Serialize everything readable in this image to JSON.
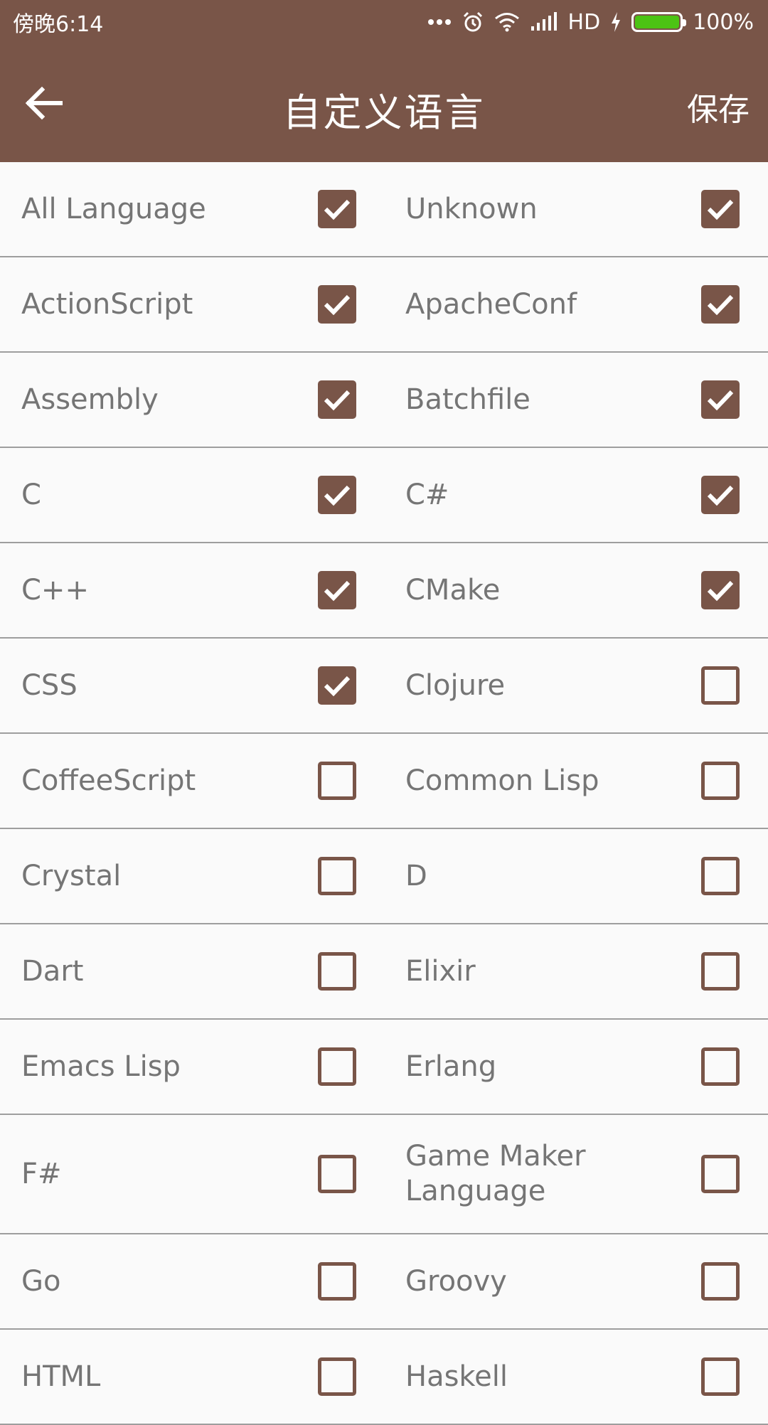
{
  "status_bar": {
    "time": "傍晚6:14",
    "network": "HD",
    "battery": "100%",
    "battery_level": 1.0
  },
  "app_bar": {
    "title": "自定义语言",
    "save_label": "保存"
  },
  "colors": {
    "primary": "#795548",
    "text": "#757575",
    "divider": "#9E9E9E",
    "battery": "#4CC314"
  },
  "rows": [
    [
      {
        "label": "All Language",
        "checked": true
      },
      {
        "label": "Unknown",
        "checked": true
      }
    ],
    [
      {
        "label": "ActionScript",
        "checked": true
      },
      {
        "label": "ApacheConf",
        "checked": true
      }
    ],
    [
      {
        "label": "Assembly",
        "checked": true
      },
      {
        "label": "Batchfile",
        "checked": true
      }
    ],
    [
      {
        "label": "C",
        "checked": true
      },
      {
        "label": "C#",
        "checked": true
      }
    ],
    [
      {
        "label": "C++",
        "checked": true
      },
      {
        "label": "CMake",
        "checked": true
      }
    ],
    [
      {
        "label": "CSS",
        "checked": true
      },
      {
        "label": "Clojure",
        "checked": false
      }
    ],
    [
      {
        "label": "CoffeeScript",
        "checked": false
      },
      {
        "label": "Common Lisp",
        "checked": false
      }
    ],
    [
      {
        "label": "Crystal",
        "checked": false
      },
      {
        "label": "D",
        "checked": false
      }
    ],
    [
      {
        "label": "Dart",
        "checked": false
      },
      {
        "label": "Elixir",
        "checked": false
      }
    ],
    [
      {
        "label": "Emacs Lisp",
        "checked": false
      },
      {
        "label": "Erlang",
        "checked": false
      }
    ],
    [
      {
        "label": "F#",
        "checked": false
      },
      {
        "label": "Game Maker Language",
        "checked": false
      }
    ],
    [
      {
        "label": "Go",
        "checked": false
      },
      {
        "label": "Groovy",
        "checked": false
      }
    ],
    [
      {
        "label": "HTML",
        "checked": false
      },
      {
        "label": "Haskell",
        "checked": false
      }
    ]
  ]
}
